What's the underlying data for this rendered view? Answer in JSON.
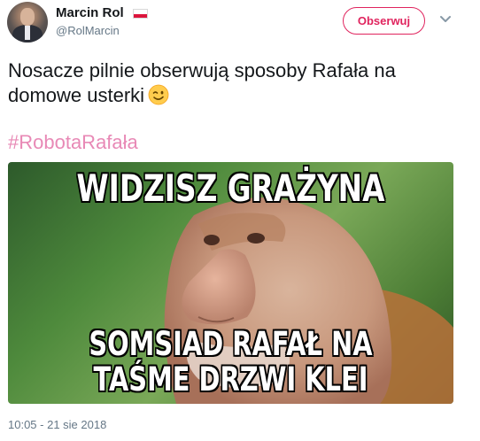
{
  "author": {
    "name": "Marcin Rol",
    "handle": "@RolMarcin"
  },
  "follow_button": {
    "label": "Obserwuj"
  },
  "tweet": {
    "text": "Nosacze pilnie obserwują sposoby Rafała na domowe usterki",
    "hashtag": "#RobotaRafała",
    "timestamp": "10:05 - 21 sie 2018"
  },
  "meme": {
    "top_text": "WIDZISZ GRAŻYNA",
    "bottom_text_line1": "SOMSIAD RAFAŁ NA",
    "bottom_text_line2": "TAŚME DRZWI KLEI"
  },
  "icons": {
    "flag": "poland-flag-icon",
    "menu": "chevron-down-icon",
    "emoji": "winking-face-icon"
  },
  "colors": {
    "accent": "#e0245e",
    "hashtag": "#e889b6",
    "text": "#14171a",
    "secondary_text": "#657786"
  }
}
